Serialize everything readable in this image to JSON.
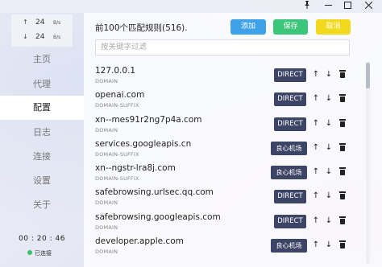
{
  "window": {
    "pin_icon": "pin-icon",
    "minimize_icon": "minimize-icon",
    "maximize_icon": "maximize-icon",
    "close_icon": "close-icon"
  },
  "sidebar": {
    "speed": {
      "up": {
        "arrow": "↑",
        "value": "24",
        "unit": "B/s"
      },
      "down": {
        "arrow": "↓",
        "value": "24",
        "unit": "B/s"
      }
    },
    "items": [
      {
        "label": "主页",
        "active": false
      },
      {
        "label": "代理",
        "active": false
      },
      {
        "label": "配置",
        "active": true
      },
      {
        "label": "日志",
        "active": false
      },
      {
        "label": "连接",
        "active": false
      },
      {
        "label": "设置",
        "active": false
      },
      {
        "label": "关于",
        "active": false
      }
    ],
    "timer": "00 : 20 : 46",
    "status": "已连接",
    "status_color": "#3cbf6a"
  },
  "main": {
    "heading": "前100个匹配规则(516).",
    "add_label": "添加",
    "save_label": "保存",
    "cancel_label": "取消",
    "filter_placeholder": "按关键字过滤",
    "rules": [
      {
        "name": "127.0.0.1",
        "type": "DOMAIN",
        "policy": "DIRECT"
      },
      {
        "name": "openai.com",
        "type": "DOMAIN-SUFFIX",
        "policy": "DIRECT"
      },
      {
        "name": "xn--mes91r2ng7p4a.com",
        "type": "DOMAIN",
        "policy": "DIRECT"
      },
      {
        "name": "services.googleapis.cn",
        "type": "DOMAIN-SUFFIX",
        "policy": "良心机场"
      },
      {
        "name": "xn--ngstr-lra8j.com",
        "type": "DOMAIN-SUFFIX",
        "policy": "良心机场"
      },
      {
        "name": "safebrowsing.urlsec.qq.com",
        "type": "DOMAIN",
        "policy": "DIRECT"
      },
      {
        "name": "safebrowsing.googleapis.com",
        "type": "DOMAIN",
        "policy": "DIRECT"
      },
      {
        "name": "developer.apple.com",
        "type": "DOMAIN",
        "policy": "良心机场"
      }
    ]
  },
  "colors": {
    "add": "#3fa2e8",
    "save": "#3cc67c",
    "cancel": "#f1d91d",
    "policy_bg": "#3d4566",
    "active_nav": "#ffffff"
  }
}
